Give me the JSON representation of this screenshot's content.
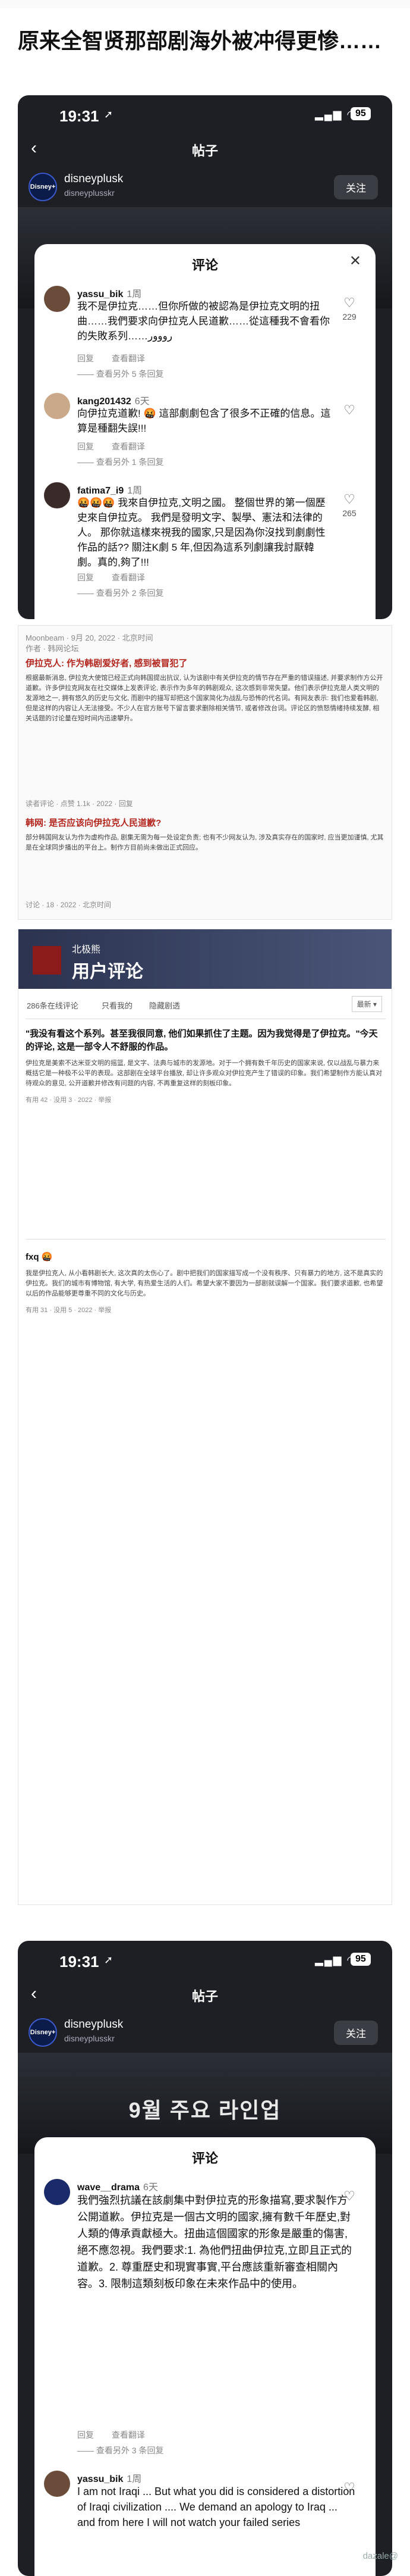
{
  "post_title": "原来全智贤那部剧海外被冲得更惨……",
  "phone": {
    "time": "19:31",
    "location_icon": "➚",
    "signal": "▂▄▆ ◠",
    "battery": "95",
    "back": "‹",
    "nav_title": "帖子",
    "handle": "disneyplusk",
    "handle2": "disneyplusskr",
    "avatar_text": "Disney+",
    "follow": "关注",
    "poster_text": "9월 주요 라인업"
  },
  "sheet1": {
    "title": "评论",
    "close": "✕",
    "comments": [
      {
        "user": "yassu_bik",
        "age": "1周",
        "text": "我不是伊拉克……但你所做的被認為是伊拉克文明的扭曲……我們要求向伊拉克人民道歉……從這種我不會看你的失敗系列……ﺭﻭﻭﻭﺭ",
        "likes": "229",
        "reply": "回复",
        "view_transl": "查看翻译",
        "more": "—— 查看另外 5 条回复"
      },
      {
        "user": "kang201432",
        "age": "6天",
        "text": "向伊拉克道歉! 🤬 這部劇劇包含了很多不正確的信息。這算是種翻失誤!!!",
        "likes": "",
        "reply": "回复",
        "view_transl": "查看翻译",
        "more": "—— 查看另外 1 条回复"
      },
      {
        "user": "fatima7_i9",
        "age": "1周",
        "text": "🤬🤬🤬 我來自伊拉克,文明之國。 整個世界的第一個歷史來自伊拉克。 我們是發明文字、製學、憲法和法律的人。 那你就這樣來視我的國家,只是因為你沒找到劇劇性作品的話?? 關注K劇 5 年,但因為這系列劇讓我討厭韓劇。真的,夠了!!!",
        "likes": "265",
        "reply": "回复",
        "view_transl": "查看翻译",
        "more": "—— 查看另外 2 条回复"
      }
    ]
  },
  "article": {
    "meta": "Moonbeam · 9月 20, 2022 · 北京时间",
    "meta2": "作者 · 韩网论坛",
    "head1": "伊拉克人: 作为韩剧爱好者, 感到被冒犯了",
    "body1": "根据最新消息, 伊拉克大使馆已经正式向韩国提出抗议, 认为该剧中有关伊拉克的情节存在严重的错误描述, 并要求制作方公开道歉。许多伊拉克网友在社交媒体上发表评论, 表示作为多年的韩剧观众, 这次感到非常失望。他们表示伊拉克是人类文明的发源地之一, 拥有悠久的历史与文化, 而剧中的描写却把这个国家简化为战乱与恐怖的代名词。有网友表示: 我们也爱看韩剧, 但是这样的内容让人无法接受。不少人在官方账号下留言要求删除相关情节, 或者修改台词。评论区的愤怒情绪持续发酵, 相关话题的讨论量在短时间内迅速攀升。",
    "foot1": "读者评论 · 点赞 1.1k · 2022 · 回复",
    "head2": "韩网: 是否应该向伊拉克人民道歉?",
    "body2": "部分韩国网友认为作为虚构作品, 剧集无需为每一处设定负责; 也有不少网友认为, 涉及真实存在的国家时, 应当更加谨慎, 尤其是在全球同步播出的平台上。制作方目前尚未做出正式回应。",
    "foot2": "讨论 · 18 · 2022 · 北京时间"
  },
  "review": {
    "org": "北极熊",
    "heading": "用户评论",
    "tabs": [
      "286条在线评论",
      "只看我的",
      "隐藏剧透"
    ],
    "sort": "最新 ▾",
    "entries": [
      {
        "title": "\"我没有看这个系列。甚至我很同意, 他们如果抓住了主题。因为我觉得是了伊拉克。\"今天的评论, 这是一部令人不舒服的作品。",
        "body": "伊拉克是美索不达米亚文明的摇篮, 是文字、法典与城市的发源地。对于一个拥有数千年历史的国家来说, 仅以战乱与暴力来概括它是一种极不公平的表现。这部剧在全球平台播放, 却让许多观众对伊拉克产生了错误的印象。我们希望制作方能认真对待观众的意见, 公开道歉并修改有问题的内容, 不再重复这样的刻板印象。",
        "foot": "有用 42 · 没用 3 · 2022 · 举报"
      },
      {
        "title": "fxq 🤬",
        "body": "我是伊拉克人, 从小看韩剧长大, 这次真的太伤心了。剧中把我们的国家描写成一个没有秩序、只有暴力的地方, 这不是真实的伊拉克。我们的城市有博物馆, 有大学, 有热爱生活的人们。希望大家不要因为一部剧就误解一个国家。我们要求道歉, 也希望以后的作品能够更尊重不同的文化与历史。",
        "foot": "有用 31 · 没用 5 · 2022 · 举报"
      }
    ]
  },
  "sheet2": {
    "title": "评论",
    "comments": [
      {
        "user": "wave__drama",
        "age": "6天",
        "text": "我們強烈抗議在該劇集中對伊拉克的形象描寫,要求製作方公開道歉。伊拉克是一個古文明的國家,擁有數千年歷史,對人類的傳承貢獻極大。扭曲這個國家的形象是嚴重的傷害,絕不應忽視。我們要求:1. 為他們扭曲伊拉克,立即且正式的道歉。2. 尊重歷史和現實事實,平台應該重新審查相關內容。3. 限制這類刻板印象在未來作品中的使用。",
        "likes": "",
        "reply": "回复",
        "view_transl": "查看翻译",
        "more": "—— 查看另外 3 条回复"
      },
      {
        "user": "yassu_bik",
        "age": "1周",
        "text": "I am not Iraqi ... But what you did is considered a distortion of Iraqi civilization .... We demand an apology to Iraq ... and from here I will not watch your failed series",
        "likes": "",
        "reply": "回复",
        "view_transl": "查看翻译",
        "more": ""
      }
    ]
  },
  "watermark": "dazale@"
}
